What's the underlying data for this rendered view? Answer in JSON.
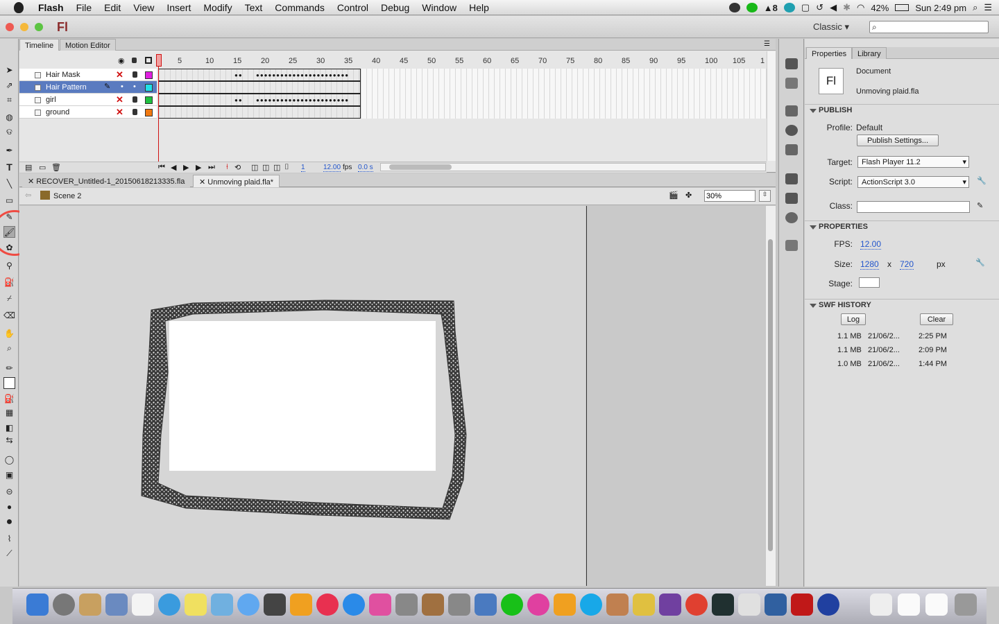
{
  "menubar": {
    "app_name": "Flash",
    "items": [
      "File",
      "Edit",
      "View",
      "Insert",
      "Modify",
      "Text",
      "Commands",
      "Control",
      "Debug",
      "Window",
      "Help"
    ],
    "adobe_badge": "8",
    "battery": "42%",
    "clock": "Sun 2:49 pm"
  },
  "appbar": {
    "logo": "Fl",
    "workspace": "Classic",
    "workspace_arrow": "▾"
  },
  "timeline": {
    "tabs": [
      "Timeline",
      "Motion Editor"
    ],
    "ruler": [
      "1",
      "5",
      "10",
      "15",
      "20",
      "25",
      "30",
      "35",
      "40",
      "45",
      "50",
      "55",
      "60",
      "65",
      "70",
      "75",
      "80",
      "85",
      "90",
      "95",
      "100",
      "105",
      "1"
    ],
    "layers": [
      {
        "name": "Hair Mask",
        "color": "#e020e0",
        "selected": false
      },
      {
        "name": "Hair Pattern",
        "color": "#20e0e8",
        "selected": true
      },
      {
        "name": "girl",
        "color": "#20c040",
        "selected": false
      },
      {
        "name": "ground",
        "color": "#f07810",
        "selected": false
      }
    ],
    "current_frame": "1",
    "fps": "12.00",
    "fps_unit": "fps",
    "time": "0.0 s"
  },
  "doc_tabs": [
    "RECOVER_Untitled-1_20150618213335.fla",
    "Unmoving plaid.fla*"
  ],
  "scene": {
    "name": "Scene 2",
    "zoom": "30%"
  },
  "properties": {
    "tabs": [
      "Properties",
      "Library"
    ],
    "doc_icon": "Fl",
    "doc_type": "Document",
    "doc_name": "Unmoving plaid.fla",
    "publish": {
      "header": "PUBLISH",
      "profile_label": "Profile:",
      "profile_value": "Default",
      "settings_btn": "Publish Settings...",
      "target_label": "Target:",
      "target_value": "Flash Player 11.2",
      "script_label": "Script:",
      "script_value": "ActionScript 3.0",
      "class_label": "Class:"
    },
    "props": {
      "header": "PROPERTIES",
      "fps_label": "FPS:",
      "fps_value": "12.00",
      "size_label": "Size:",
      "width": "1280",
      "x": "x",
      "height": "720",
      "unit": "px",
      "stage_label": "Stage:"
    },
    "swf_history": {
      "header": "SWF HISTORY",
      "log_btn": "Log",
      "clear_btn": "Clear",
      "entries": [
        {
          "size": "1.1 MB",
          "date": "21/06/2...",
          "time": "2:25 PM"
        },
        {
          "size": "1.1 MB",
          "date": "21/06/2...",
          "time": "2:09 PM"
        },
        {
          "size": "1.0 MB",
          "date": "21/06/2...",
          "time": "1:44 PM"
        }
      ]
    }
  },
  "colors": {
    "highlight_circle": "#ef4b42",
    "selected_layer": "#5a7bc0",
    "link_blue": "#2255cc",
    "playhead": "#d01010"
  }
}
